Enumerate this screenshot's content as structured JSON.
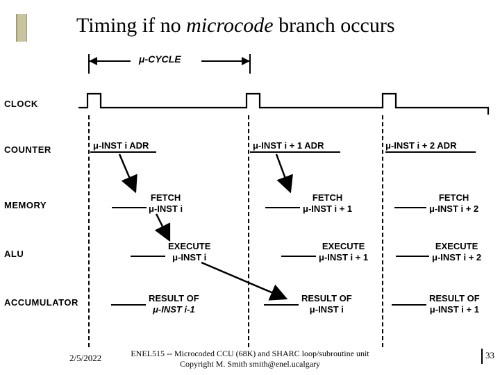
{
  "title": {
    "pre": "Timing if no ",
    "ital": "microcode",
    "post": " branch occurs"
  },
  "rows": {
    "clock": "CLOCK",
    "counter": "COUNTER",
    "memory": "MEMORY",
    "alu": "ALU",
    "accum": "ACCUMULATOR"
  },
  "cycle_label_html": "μ-CYCLE",
  "cells": {
    "counter1": "μ-INST i ADR",
    "counter2": "μ-INST i + 1 ADR",
    "counter3": "μ-INST i + 2 ADR",
    "mem1_top": "FETCH",
    "mem1_bot": "μ-INST i",
    "mem2_top": "FETCH",
    "mem2_bot": "μ-INST i + 1",
    "mem3_top": "FETCH",
    "mem3_bot": "μ-INST i + 2",
    "alu1_top": "EXECUTE",
    "alu1_bot": "μ-INST i",
    "alu2_top": "EXECUTE",
    "alu2_bot": "μ-INST i + 1",
    "alu3_top": "EXECUTE",
    "alu3_bot": "μ-INST i + 2",
    "acc1_top": "RESULT OF",
    "acc1_bot": "μ-INST i-1",
    "acc2_top": "RESULT OF",
    "acc2_bot": "μ-INST i",
    "acc3_top": "RESULT OF",
    "acc3_bot": "μ-INST i + 1"
  },
  "footer": {
    "date": "2/5/2022",
    "line1": "ENEL515 -- Microcoded CCU (68K) and SHARC loop/subroutine unit",
    "line2": "Copyright M. Smith smith@enel.ucalgary",
    "page": "33"
  }
}
